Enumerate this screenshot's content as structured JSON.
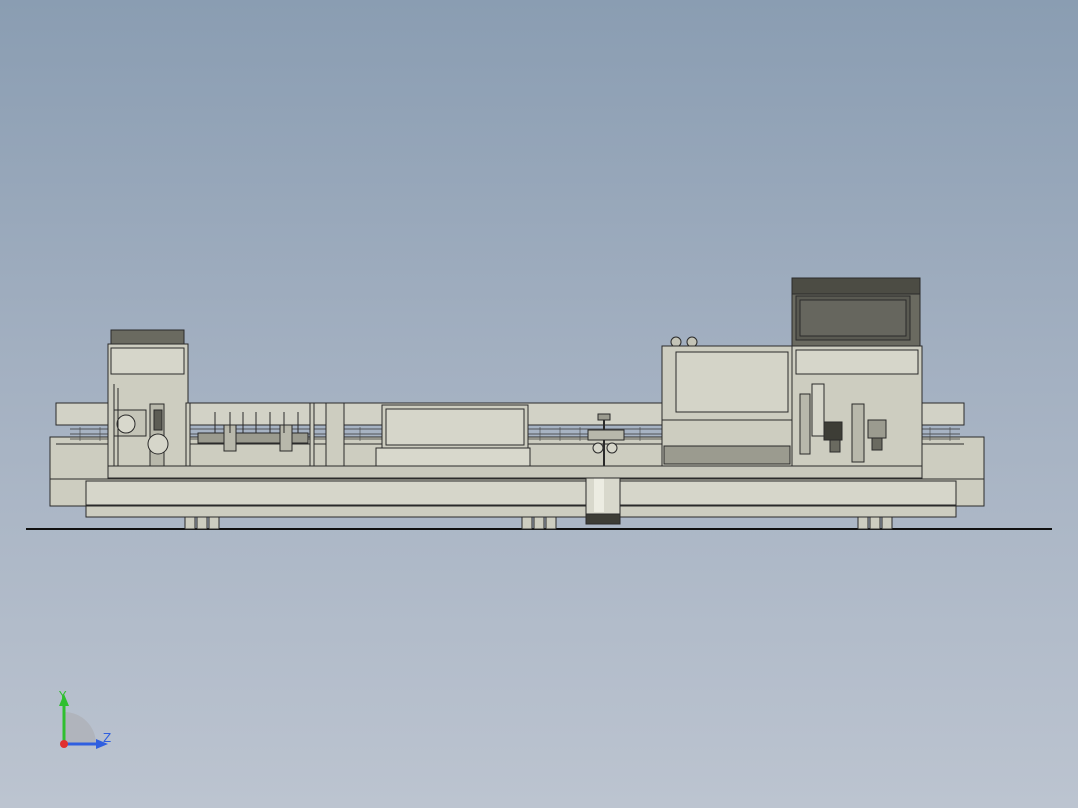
{
  "viewport": {
    "background_top": "#8a9db2",
    "background_bottom": "#bcc4d0",
    "model_fill": "#cdcdc0",
    "model_stroke": "#2a2a2a"
  },
  "triad": {
    "y_label": "Y",
    "z_label": "Z",
    "y_color": "#2fbf2f",
    "z_color": "#2f5fe0",
    "x_color": "#e02f2f"
  }
}
